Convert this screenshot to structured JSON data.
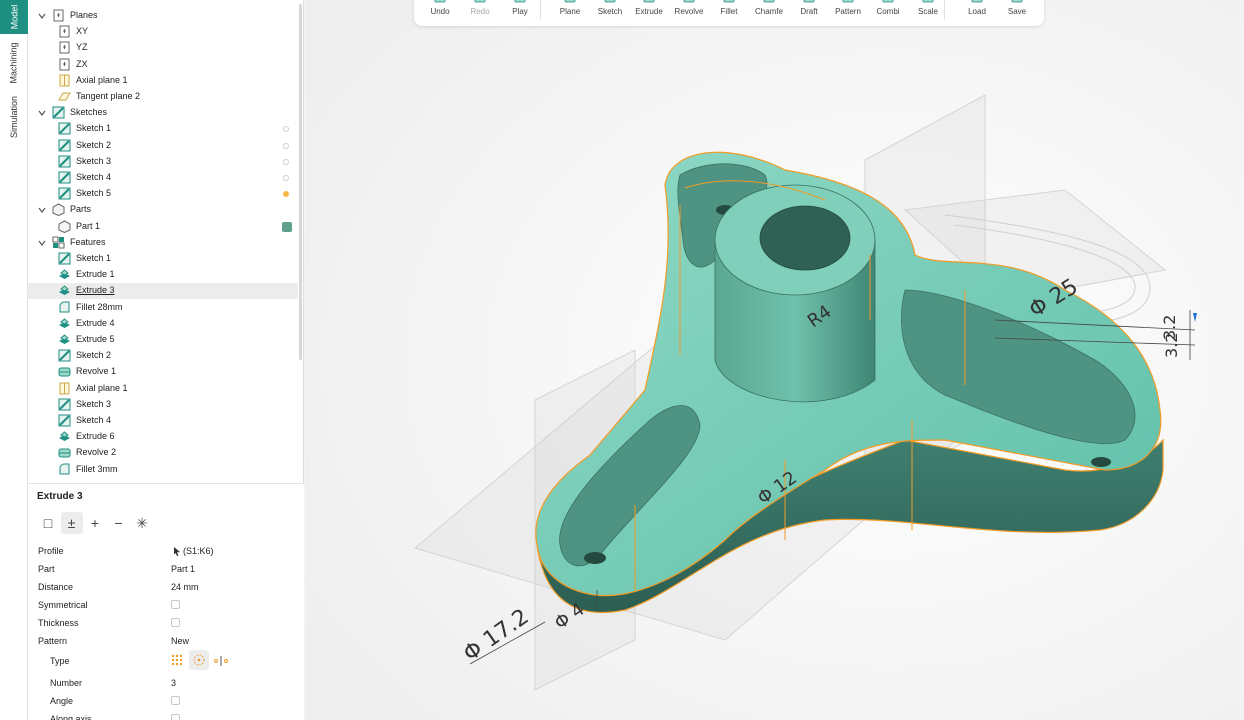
{
  "vertical_tabs": [
    {
      "label": "Model",
      "active": true
    },
    {
      "label": "Machining",
      "active": false
    },
    {
      "label": "Simulation",
      "active": false
    }
  ],
  "tree": [
    {
      "label": "Planes",
      "level": 0,
      "icon": "plane-group-icon",
      "expanded": true
    },
    {
      "label": "XY",
      "level": 1,
      "icon": "plane-icon"
    },
    {
      "label": "YZ",
      "level": 1,
      "icon": "plane-icon"
    },
    {
      "label": "ZX",
      "level": 1,
      "icon": "plane-icon"
    },
    {
      "label": "Axial plane 1",
      "level": 1,
      "icon": "axial-plane-icon"
    },
    {
      "label": "Tangent plane 2",
      "level": 1,
      "icon": "tangent-plane-icon"
    },
    {
      "label": "Sketches",
      "level": 0,
      "icon": "sketch-icon",
      "expanded": true
    },
    {
      "label": "Sketch 1",
      "level": 1,
      "icon": "sketch-icon",
      "visibility": "off"
    },
    {
      "label": "Sketch 2",
      "level": 1,
      "icon": "sketch-icon",
      "visibility": "off"
    },
    {
      "label": "Sketch 3",
      "level": 1,
      "icon": "sketch-icon",
      "visibility": "off"
    },
    {
      "label": "Sketch 4",
      "level": 1,
      "icon": "sketch-icon",
      "visibility": "off"
    },
    {
      "label": "Sketch 5",
      "level": 1,
      "icon": "sketch-icon",
      "visibility": "on"
    },
    {
      "label": "Parts",
      "level": 0,
      "icon": "part-icon",
      "expanded": true
    },
    {
      "label": "Part 1",
      "level": 1,
      "icon": "part-icon",
      "color": "#5fa08e"
    },
    {
      "label": "Features",
      "level": 0,
      "icon": "features-icon",
      "expanded": true
    },
    {
      "label": "Sketch 1",
      "level": 1,
      "icon": "sketch-icon"
    },
    {
      "label": "Extrude 1",
      "level": 1,
      "icon": "extrude-icon"
    },
    {
      "label": "Extrude 3",
      "level": 1,
      "icon": "extrude-icon",
      "selected": true
    },
    {
      "label": "Fillet 28mm",
      "level": 1,
      "icon": "fillet-icon"
    },
    {
      "label": "Extrude 4",
      "level": 1,
      "icon": "extrude-icon"
    },
    {
      "label": "Extrude 5",
      "level": 1,
      "icon": "extrude-icon"
    },
    {
      "label": "Sketch 2",
      "level": 1,
      "icon": "sketch-icon"
    },
    {
      "label": "Revolve 1",
      "level": 1,
      "icon": "revolve-icon"
    },
    {
      "label": "Axial plane 1",
      "level": 1,
      "icon": "axial-plane-icon"
    },
    {
      "label": "Sketch 3",
      "level": 1,
      "icon": "sketch-icon"
    },
    {
      "label": "Sketch 4",
      "level": 1,
      "icon": "sketch-icon"
    },
    {
      "label": "Extrude 6",
      "level": 1,
      "icon": "extrude-icon"
    },
    {
      "label": "Revolve 2",
      "level": 1,
      "icon": "revolve-icon"
    },
    {
      "label": "Fillet 3mm",
      "level": 1,
      "icon": "fillet-icon"
    }
  ],
  "properties": {
    "title": "Extrude 3",
    "mode_buttons": [
      {
        "symbol": "□",
        "icon": "new-body-icon"
      },
      {
        "symbol": "±",
        "icon": "add-subtract-icon",
        "active": true
      },
      {
        "symbol": "+",
        "icon": "add-icon"
      },
      {
        "symbol": "−",
        "icon": "subtract-icon"
      },
      {
        "symbol": "✳",
        "icon": "intersect-icon"
      }
    ],
    "rows": [
      {
        "label": "Profile",
        "value": "(S1:K6)",
        "kind": "text",
        "icon": "cursor-icon"
      },
      {
        "label": "Part",
        "value": "Part 1",
        "kind": "text"
      },
      {
        "label": "Distance",
        "value": "24 mm",
        "kind": "text"
      },
      {
        "label": "Symmetrical",
        "kind": "checkbox",
        "checked": false
      },
      {
        "label": "Thickness",
        "kind": "checkbox",
        "checked": false
      },
      {
        "label": "Pattern",
        "value": "New",
        "kind": "text"
      },
      {
        "label": "Type",
        "kind": "pattern-type",
        "indent": true
      },
      {
        "label": "Number",
        "value": "3",
        "kind": "text",
        "indent": true
      },
      {
        "label": "Angle",
        "kind": "checkbox",
        "checked": false,
        "indent": true
      },
      {
        "label": "Along axis",
        "kind": "checkbox",
        "checked": false,
        "indent": true
      }
    ]
  },
  "toolbar": [
    {
      "label": "Undo",
      "icon": "undo-icon"
    },
    {
      "label": "Redo",
      "icon": "redo-icon",
      "disabled": true
    },
    {
      "label": "Play",
      "icon": "play-icon"
    },
    {
      "label": "Plane",
      "icon": "plane-icon"
    },
    {
      "label": "Sketch",
      "icon": "sketch-icon"
    },
    {
      "label": "Extrude",
      "icon": "extrude-icon"
    },
    {
      "label": "Revolve",
      "icon": "revolve-icon"
    },
    {
      "label": "Fillet",
      "icon": "fillet-icon"
    },
    {
      "label": "Chamfe",
      "icon": "chamfer-icon"
    },
    {
      "label": "Draft",
      "icon": "draft-icon"
    },
    {
      "label": "Pattern",
      "icon": "pattern-icon"
    },
    {
      "label": "Combi",
      "icon": "combine-icon"
    },
    {
      "label": "Scale",
      "icon": "scale-icon"
    },
    {
      "label": "Load",
      "icon": "load-icon"
    },
    {
      "label": "Save",
      "icon": "save-icon"
    }
  ],
  "dimensions": [
    "Φ 25",
    "3.2",
    "3.2",
    "R4",
    "Φ 12",
    "Φ 17.2",
    "Φ 4"
  ],
  "colors": {
    "accent": "#1f8f82",
    "part": "#5fa08e",
    "edge_highlight": "#f29b25",
    "selected_row": "#ececec",
    "visibility_on": "#f5b942"
  }
}
